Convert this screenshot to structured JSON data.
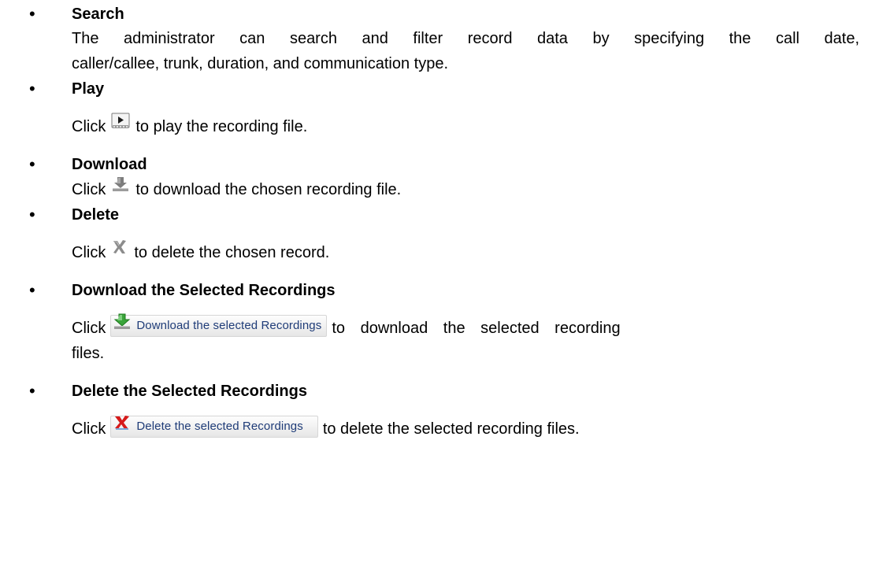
{
  "bullet_char": "•",
  "sections": {
    "search": {
      "title": "Search",
      "line1": "The administrator can search and filter record data by specifying the call date,",
      "line2": "caller/callee, trunk, duration, and communication type."
    },
    "play": {
      "title": "Play",
      "click": "Click",
      "after": "to play the recording file.",
      "icon": "play-icon"
    },
    "download": {
      "title": "Download",
      "click": "Click",
      "after": "to download the chosen recording file.",
      "icon": "download-icon"
    },
    "delete": {
      "title": "Delete",
      "click": "Click",
      "after": "to delete the chosen record.",
      "icon": "delete-icon"
    },
    "download_selected": {
      "title": "Download the Selected Recordings",
      "click": "Click",
      "button_label": "Download the selected Recordings",
      "after_line1": "to download the selected recording",
      "after_line2": "files.",
      "icon": "download-green-icon"
    },
    "delete_selected": {
      "title": "Delete the Selected Recordings",
      "click": "Click",
      "button_label": "Delete the selected Recordings",
      "after": "to delete the selected recording files.",
      "icon": "delete-red-icon"
    }
  },
  "colors": {
    "text": "#000000",
    "button_text": "#1f3c78",
    "download_green": "#3aa43a",
    "delete_red": "#d61a1a"
  }
}
